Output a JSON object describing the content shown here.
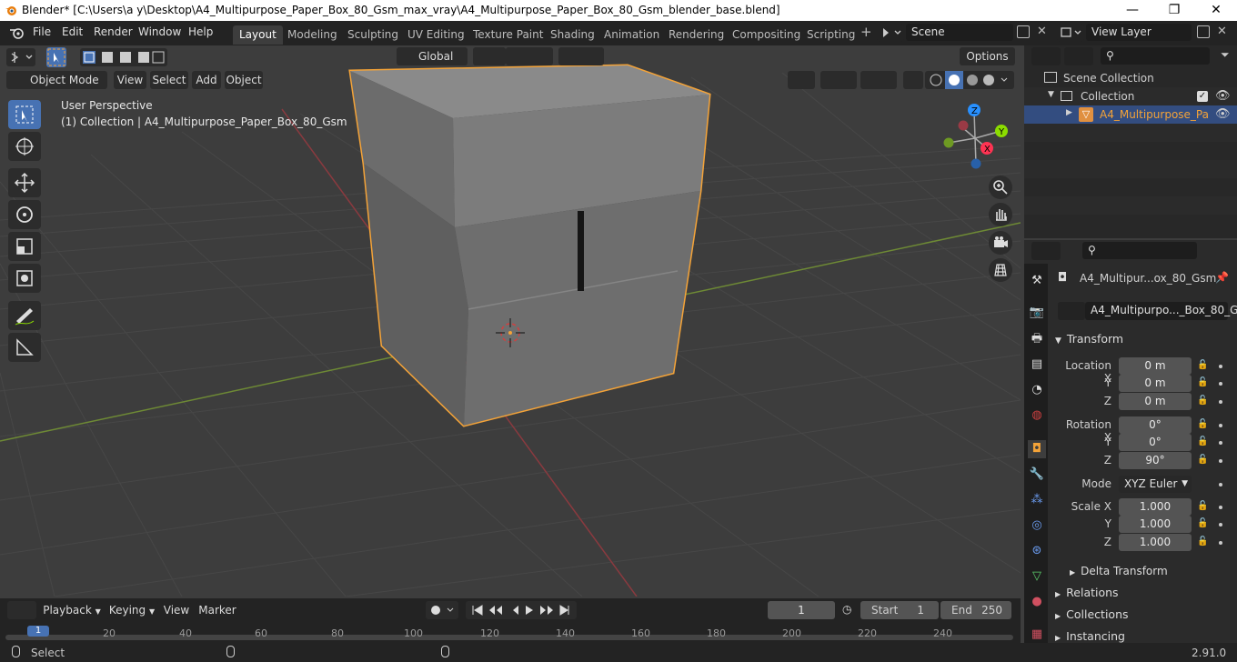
{
  "titlebar": {
    "title": "Blender* [C:\\Users\\a y\\Desktop\\A4_Multipurpose_Paper_Box_80_Gsm_max_vray\\A4_Multipurpose_Paper_Box_80_Gsm_blender_base.blend]",
    "minimize": "—",
    "maximize": "❐",
    "close": "✕"
  },
  "menubar": {
    "menus": [
      "File",
      "Edit",
      "Render",
      "Window",
      "Help"
    ],
    "workspaces": [
      "Layout",
      "Modeling",
      "Sculpting",
      "UV Editing",
      "Texture Paint",
      "Shading",
      "Animation",
      "Rendering",
      "Compositing",
      "Scripting"
    ],
    "active_workspace": "Layout",
    "add_tab": "+",
    "scene": "Scene",
    "view_layer": "View Layer"
  },
  "viewport_header": {
    "transform_orientation": "Global",
    "options": "Options",
    "mode": "Object Mode",
    "menus": [
      "View",
      "Select",
      "Add",
      "Object"
    ]
  },
  "viewport": {
    "perspective": "User Perspective",
    "collection_info": "(1) Collection | A4_Multipurpose_Paper_Box_80_Gsm",
    "gizmo_axes": [
      "X",
      "Y",
      "Z"
    ]
  },
  "outliner": {
    "scene_collection": "Scene Collection",
    "collection": "Collection",
    "object": "A4_Multipurpose_Pa"
  },
  "properties": {
    "object_name": "A4_Multipur...ox_80_Gsm",
    "data_name": "A4_Multipurpo..._Box_80_Gsm",
    "transform_header": "Transform",
    "location_label": "Location X",
    "rotation_label": "Rotation X",
    "scale_label": "Scale X",
    "y_label": "Y",
    "z_label": "Z",
    "location": [
      "0 m",
      "0 m",
      "0 m"
    ],
    "rotation": [
      "0°",
      "0°",
      "90°"
    ],
    "mode_label": "Mode",
    "mode_value": "XYZ Euler",
    "scale": [
      "1.000",
      "1.000",
      "1.000"
    ],
    "delta_transform": "Delta Transform",
    "relations": "Relations",
    "collections": "Collections",
    "instancing": "Instancing"
  },
  "timeline": {
    "menus": [
      "Playback",
      "Keying",
      "View",
      "Marker"
    ],
    "current_frame": "1",
    "start_label": "Start",
    "start_value": "1",
    "end_label": "End",
    "end_value": "250",
    "ticks": [
      "20",
      "40",
      "60",
      "80",
      "100",
      "120",
      "140",
      "160",
      "180",
      "200",
      "220",
      "240"
    ],
    "playhead": "1"
  },
  "statusbar": {
    "action": "Select",
    "version": "2.91.0"
  },
  "colors": {
    "accent_blue": "#4772b3",
    "selection_orange": "#f4a338",
    "axis_x": "#ff3352",
    "axis_y": "#8bdc00",
    "axis_z": "#2890ff"
  }
}
